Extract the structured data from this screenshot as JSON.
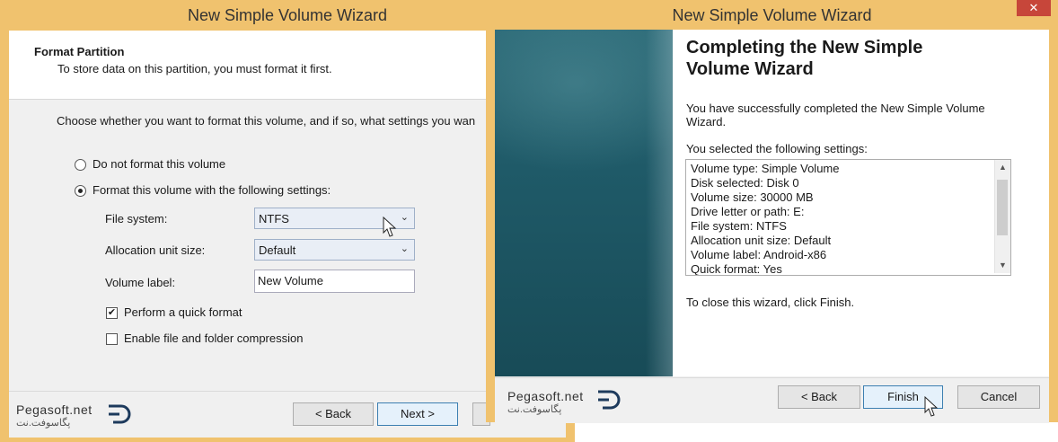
{
  "left_window": {
    "title": "New Simple Volume Wizard",
    "header_title": "Format Partition",
    "header_subtitle": "To store data on this partition, you must format it first.",
    "instruction": "Choose whether you want to format this volume, and if so, what settings you wan",
    "radio_no_format": "Do not format this volume",
    "radio_format": "Format this volume with the following settings:",
    "file_system_label": "File system:",
    "file_system_value": "NTFS",
    "alloc_label": "Allocation unit size:",
    "alloc_value": "Default",
    "volume_label_label": "Volume label:",
    "volume_label_value": "New Volume",
    "quick_format": "Perform a quick format",
    "compression": "Enable file and folder compression",
    "back_button": "< Back",
    "next_button": "Next >",
    "logo_text": "Pegasoft.net",
    "logo_arabic": "پگاسوفت.نت"
  },
  "right_window": {
    "title": "New Simple Volume Wizard",
    "close_label": "✕",
    "heading": "Completing the New Simple Volume Wizard",
    "success_text": "You have successfully completed the New Simple Volume Wizard.",
    "settings_intro": "You selected the following settings:",
    "settings": [
      "Volume type: Simple Volume",
      "Disk selected: Disk 0",
      "Volume size: 30000 MB",
      "Drive letter or path: E:",
      "File system: NTFS",
      "Allocation unit size: Default",
      "Volume label: Android-x86",
      "Quick format: Yes"
    ],
    "close_hint": "To close this wizard, click Finish.",
    "back_button": "< Back",
    "finish_button": "Finish",
    "cancel_button": "Cancel",
    "logo_text": "Pegasoft.net",
    "logo_arabic": "پگاسوفت.نت"
  }
}
